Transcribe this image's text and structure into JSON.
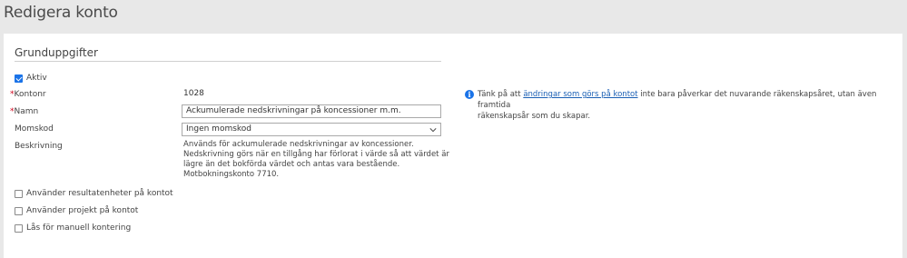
{
  "header": {
    "title": "Redigera konto"
  },
  "section": {
    "title": "Grunduppgifter"
  },
  "form": {
    "active_label": "Aktiv",
    "active_checked": true,
    "account_number_label": "Kontonr",
    "account_number_value": "1028",
    "name_label": "Namn",
    "name_value": "Ackumulerade nedskrivningar på koncessioner m.m.",
    "vat_code_label": "Momskod",
    "vat_code_value": "Ingen momskod",
    "description_label": "Beskrivning",
    "description_lines": [
      "Används för ackumulerade nedskrivningar av koncessioner.",
      "Nedskrivning görs när en tillgång har förlorat i värde så att värdet är",
      "lägre än det bokförda värdet och antas vara bestående.",
      "Motbokningskonto 7710."
    ],
    "required_marker": "*",
    "options": [
      {
        "label": "Använder resultatenheter på kontot",
        "checked": false
      },
      {
        "label": "Använder projekt på kontot",
        "checked": false
      },
      {
        "label": "Lås för manuell kontering",
        "checked": false
      }
    ]
  },
  "info": {
    "icon": "info-icon",
    "icon_glyph": "i",
    "text_before": "Tänk på att ",
    "link_text": "ändringar som görs på kontot",
    "text_after_line1": " inte bara påverkar det nuvarande räkenskapsåret, utan även framtida",
    "text_line2": "räkenskapsår som du skapar."
  },
  "colors": {
    "accent": "#1a73e8",
    "link": "#1a5fb4",
    "required": "#d0021b",
    "page_bg": "#e8e8e8"
  }
}
